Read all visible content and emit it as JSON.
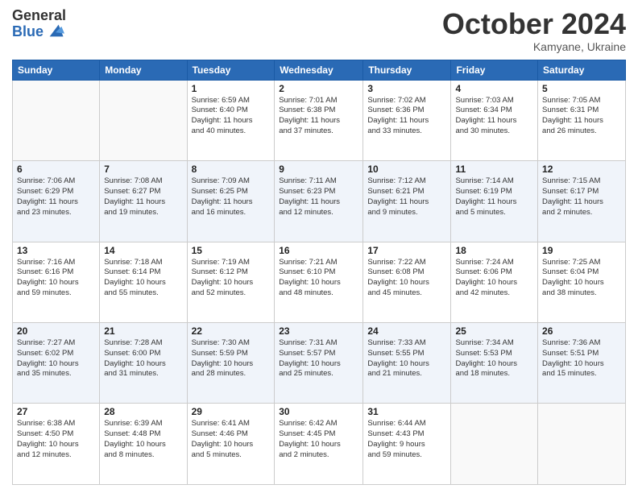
{
  "logo": {
    "general": "General",
    "blue": "Blue"
  },
  "header": {
    "month": "October 2024",
    "location": "Kamyane, Ukraine"
  },
  "days_of_week": [
    "Sunday",
    "Monday",
    "Tuesday",
    "Wednesday",
    "Thursday",
    "Friday",
    "Saturday"
  ],
  "weeks": [
    [
      {
        "day": "",
        "info": ""
      },
      {
        "day": "",
        "info": ""
      },
      {
        "day": "1",
        "info": "Sunrise: 6:59 AM\nSunset: 6:40 PM\nDaylight: 11 hours\nand 40 minutes."
      },
      {
        "day": "2",
        "info": "Sunrise: 7:01 AM\nSunset: 6:38 PM\nDaylight: 11 hours\nand 37 minutes."
      },
      {
        "day": "3",
        "info": "Sunrise: 7:02 AM\nSunset: 6:36 PM\nDaylight: 11 hours\nand 33 minutes."
      },
      {
        "day": "4",
        "info": "Sunrise: 7:03 AM\nSunset: 6:34 PM\nDaylight: 11 hours\nand 30 minutes."
      },
      {
        "day": "5",
        "info": "Sunrise: 7:05 AM\nSunset: 6:31 PM\nDaylight: 11 hours\nand 26 minutes."
      }
    ],
    [
      {
        "day": "6",
        "info": "Sunrise: 7:06 AM\nSunset: 6:29 PM\nDaylight: 11 hours\nand 23 minutes."
      },
      {
        "day": "7",
        "info": "Sunrise: 7:08 AM\nSunset: 6:27 PM\nDaylight: 11 hours\nand 19 minutes."
      },
      {
        "day": "8",
        "info": "Sunrise: 7:09 AM\nSunset: 6:25 PM\nDaylight: 11 hours\nand 16 minutes."
      },
      {
        "day": "9",
        "info": "Sunrise: 7:11 AM\nSunset: 6:23 PM\nDaylight: 11 hours\nand 12 minutes."
      },
      {
        "day": "10",
        "info": "Sunrise: 7:12 AM\nSunset: 6:21 PM\nDaylight: 11 hours\nand 9 minutes."
      },
      {
        "day": "11",
        "info": "Sunrise: 7:14 AM\nSunset: 6:19 PM\nDaylight: 11 hours\nand 5 minutes."
      },
      {
        "day": "12",
        "info": "Sunrise: 7:15 AM\nSunset: 6:17 PM\nDaylight: 11 hours\nand 2 minutes."
      }
    ],
    [
      {
        "day": "13",
        "info": "Sunrise: 7:16 AM\nSunset: 6:16 PM\nDaylight: 10 hours\nand 59 minutes."
      },
      {
        "day": "14",
        "info": "Sunrise: 7:18 AM\nSunset: 6:14 PM\nDaylight: 10 hours\nand 55 minutes."
      },
      {
        "day": "15",
        "info": "Sunrise: 7:19 AM\nSunset: 6:12 PM\nDaylight: 10 hours\nand 52 minutes."
      },
      {
        "day": "16",
        "info": "Sunrise: 7:21 AM\nSunset: 6:10 PM\nDaylight: 10 hours\nand 48 minutes."
      },
      {
        "day": "17",
        "info": "Sunrise: 7:22 AM\nSunset: 6:08 PM\nDaylight: 10 hours\nand 45 minutes."
      },
      {
        "day": "18",
        "info": "Sunrise: 7:24 AM\nSunset: 6:06 PM\nDaylight: 10 hours\nand 42 minutes."
      },
      {
        "day": "19",
        "info": "Sunrise: 7:25 AM\nSunset: 6:04 PM\nDaylight: 10 hours\nand 38 minutes."
      }
    ],
    [
      {
        "day": "20",
        "info": "Sunrise: 7:27 AM\nSunset: 6:02 PM\nDaylight: 10 hours\nand 35 minutes."
      },
      {
        "day": "21",
        "info": "Sunrise: 7:28 AM\nSunset: 6:00 PM\nDaylight: 10 hours\nand 31 minutes."
      },
      {
        "day": "22",
        "info": "Sunrise: 7:30 AM\nSunset: 5:59 PM\nDaylight: 10 hours\nand 28 minutes."
      },
      {
        "day": "23",
        "info": "Sunrise: 7:31 AM\nSunset: 5:57 PM\nDaylight: 10 hours\nand 25 minutes."
      },
      {
        "day": "24",
        "info": "Sunrise: 7:33 AM\nSunset: 5:55 PM\nDaylight: 10 hours\nand 21 minutes."
      },
      {
        "day": "25",
        "info": "Sunrise: 7:34 AM\nSunset: 5:53 PM\nDaylight: 10 hours\nand 18 minutes."
      },
      {
        "day": "26",
        "info": "Sunrise: 7:36 AM\nSunset: 5:51 PM\nDaylight: 10 hours\nand 15 minutes."
      }
    ],
    [
      {
        "day": "27",
        "info": "Sunrise: 6:38 AM\nSunset: 4:50 PM\nDaylight: 10 hours\nand 12 minutes."
      },
      {
        "day": "28",
        "info": "Sunrise: 6:39 AM\nSunset: 4:48 PM\nDaylight: 10 hours\nand 8 minutes."
      },
      {
        "day": "29",
        "info": "Sunrise: 6:41 AM\nSunset: 4:46 PM\nDaylight: 10 hours\nand 5 minutes."
      },
      {
        "day": "30",
        "info": "Sunrise: 6:42 AM\nSunset: 4:45 PM\nDaylight: 10 hours\nand 2 minutes."
      },
      {
        "day": "31",
        "info": "Sunrise: 6:44 AM\nSunset: 4:43 PM\nDaylight: 9 hours\nand 59 minutes."
      },
      {
        "day": "",
        "info": ""
      },
      {
        "day": "",
        "info": ""
      }
    ]
  ]
}
